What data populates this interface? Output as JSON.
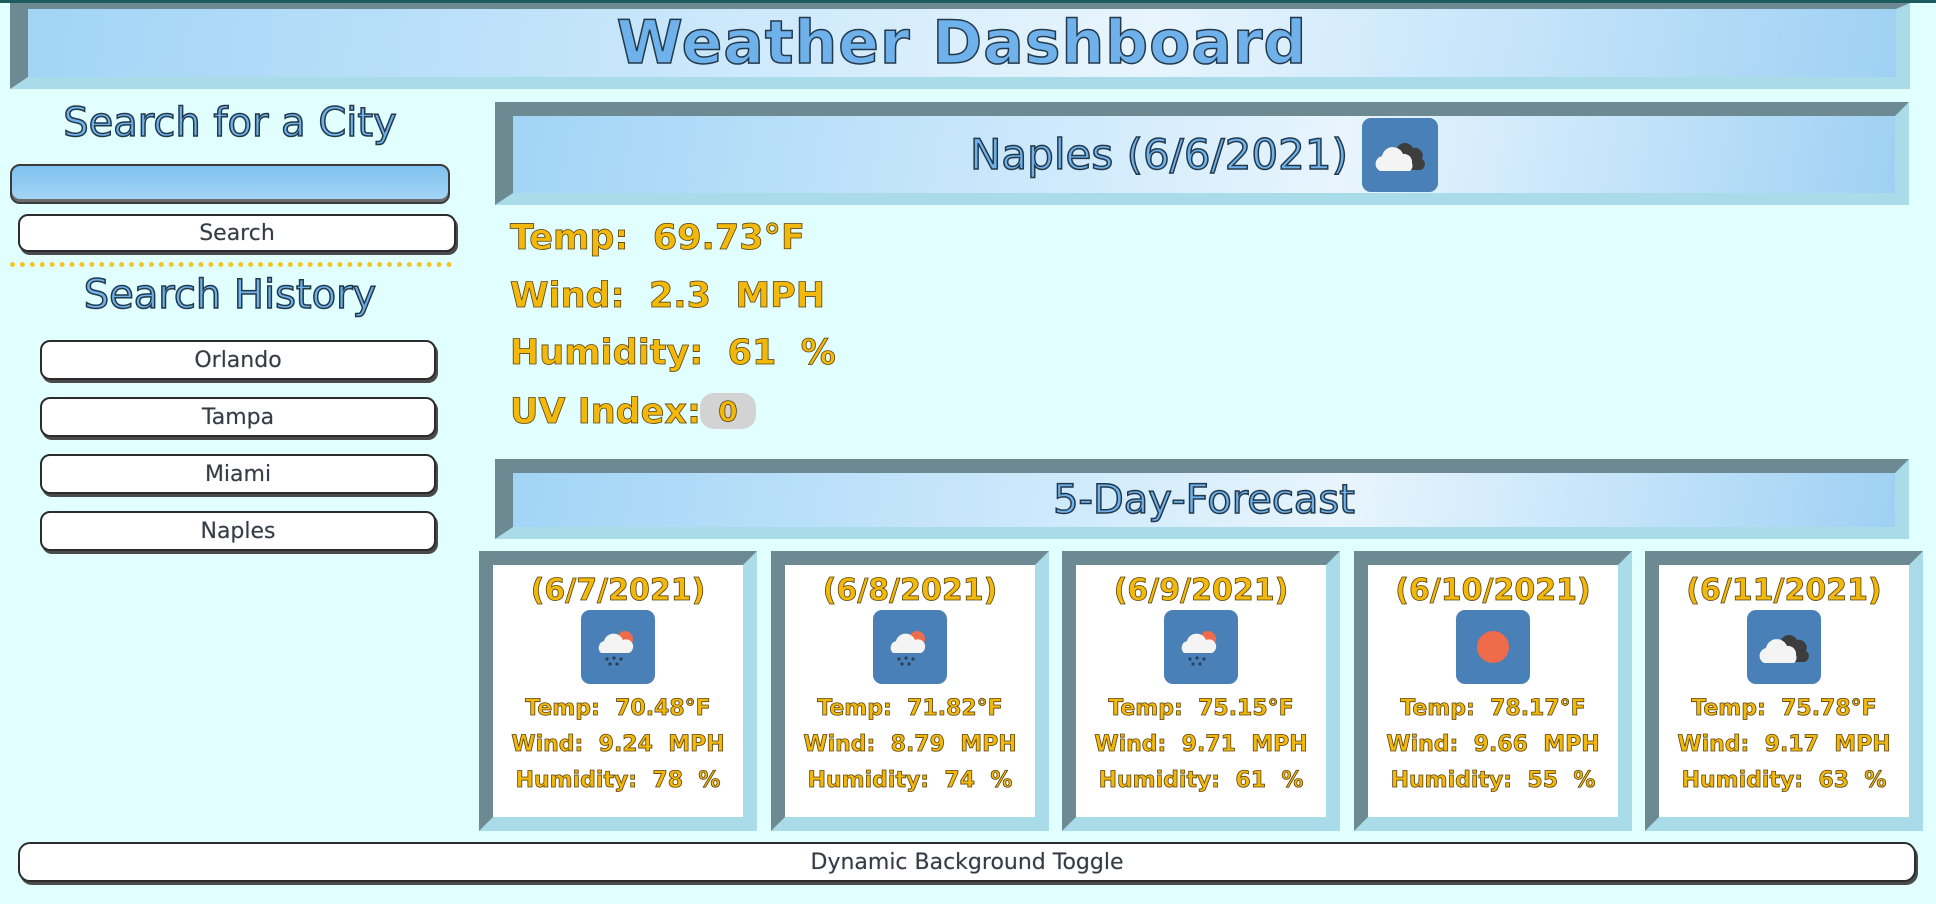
{
  "header": {
    "title": "Weather Dashboard"
  },
  "sidebar": {
    "search_heading": "Search for a City",
    "search_input_value": "",
    "search_button": "Search",
    "history_heading": "Search History",
    "history": [
      "Orlando",
      "Tampa",
      "Miami",
      "Naples"
    ]
  },
  "current": {
    "title": "Naples (6/6/2021)",
    "icon": "cloudy-icon",
    "temp": "Temp:  69.73°F",
    "wind": "Wind:  2.3  MPH",
    "humidity": "Humidity:  61  %",
    "uv_label": "UV Index:",
    "uv_value": "0"
  },
  "forecast": {
    "title": "5-Day-Forecast",
    "days": [
      {
        "date": "(6/7/2021)",
        "icon": "sun-rain-icon",
        "temp": "Temp:  70.48°F",
        "wind": "Wind:  9.24  MPH",
        "humidity": "Humidity:  78  %"
      },
      {
        "date": "(6/8/2021)",
        "icon": "sun-rain-icon",
        "temp": "Temp:  71.82°F",
        "wind": "Wind:  8.79  MPH",
        "humidity": "Humidity:  74  %"
      },
      {
        "date": "(6/9/2021)",
        "icon": "sun-rain-icon",
        "temp": "Temp:  75.15°F",
        "wind": "Wind:  9.71  MPH",
        "humidity": "Humidity:  61  %"
      },
      {
        "date": "(6/10/2021)",
        "icon": "sun-icon",
        "temp": "Temp:  78.17°F",
        "wind": "Wind:  9.66  MPH",
        "humidity": "Humidity:  55  %"
      },
      {
        "date": "(6/11/2021)",
        "icon": "cloudy-icon",
        "temp": "Temp:  75.78°F",
        "wind": "Wind:  9.17  MPH",
        "humidity": "Humidity:  63  %"
      }
    ]
  },
  "footer": {
    "toggle_label": "Dynamic Background Toggle"
  },
  "colors": {
    "page_bg": "#e0fffe",
    "heading_fill": "#6fb1ea",
    "stat_gold": "#f2b90c",
    "icon_tile": "#4a80b8",
    "frame_dark": "#6d8a93",
    "frame_light": "#a9dce8"
  }
}
